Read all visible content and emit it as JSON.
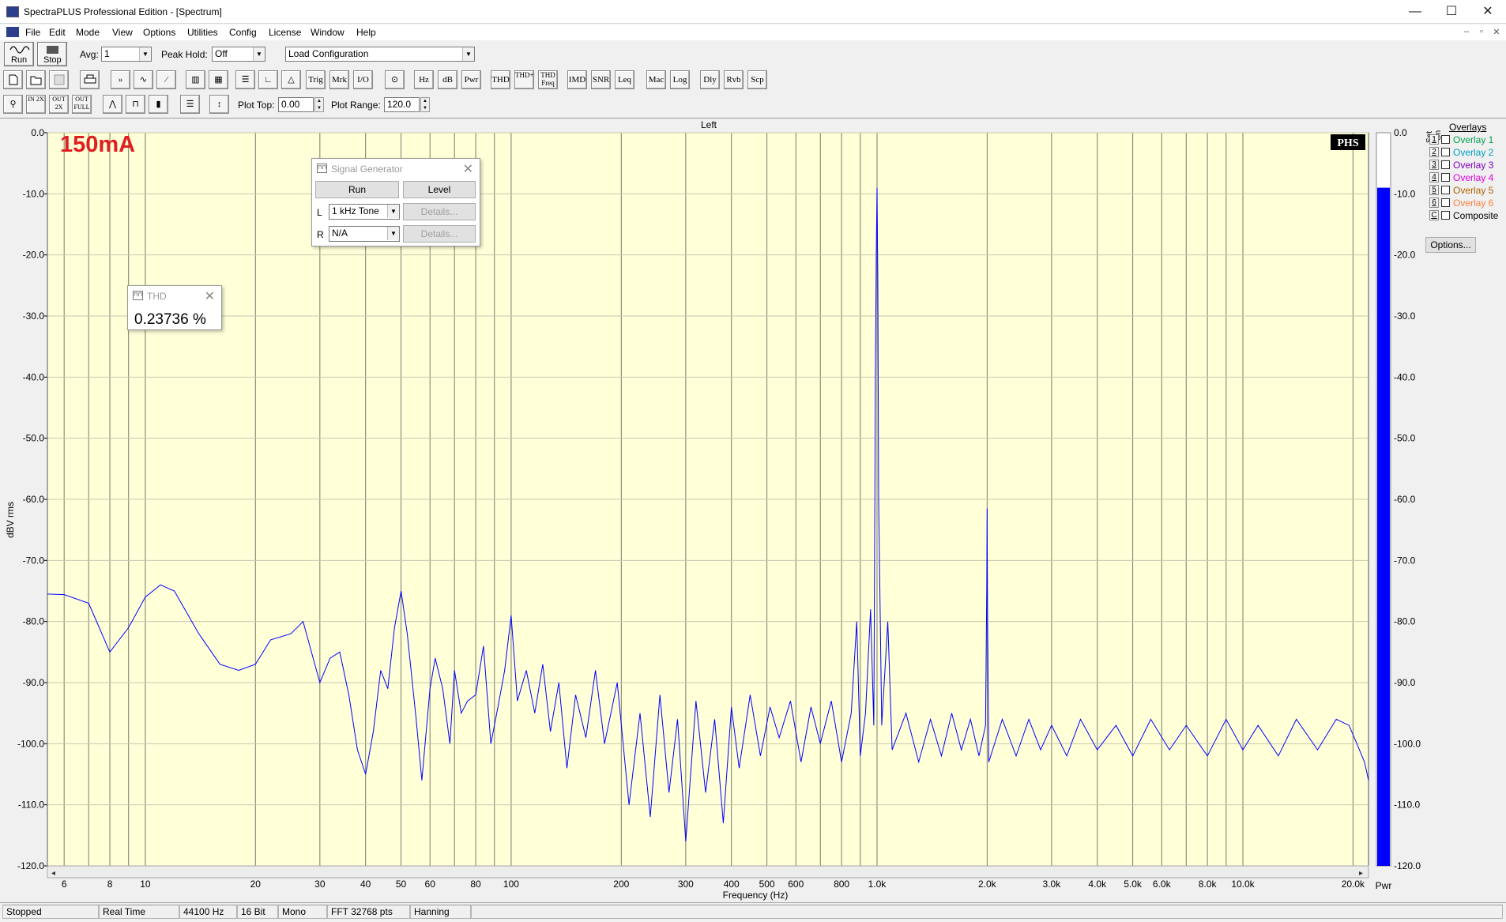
{
  "window": {
    "title": "SpectraPLUS Professional Edition - [Spectrum]",
    "controls": [
      "—",
      "☐",
      "✕"
    ]
  },
  "menu": [
    "File",
    "Edit",
    "Mode",
    "View",
    "Options",
    "Utilities",
    "Config",
    "License",
    "Window",
    "Help"
  ],
  "mdi_controls": [
    "–",
    "▫",
    "✕"
  ],
  "toolbar1": {
    "run_label": "Run",
    "stop_label": "Stop",
    "avg_label": "Avg:",
    "avg_value": "1",
    "peakhold_label": "Peak Hold:",
    "peakhold_value": "Off",
    "config_value": "Load Configuration"
  },
  "toolbar2": [
    "Trig",
    "Mrk",
    "I/O",
    "Hz",
    "dB",
    "Pwr",
    "THD",
    "THD+N",
    "THD Freq",
    "IMD",
    "SNR",
    "Leq",
    "Mac",
    "Log",
    "Dly",
    "Rvb",
    "Scp"
  ],
  "toolbar3": {
    "plot_top_label": "Plot Top:",
    "plot_top_value": "0.00",
    "plot_range_label": "Plot Range:",
    "plot_range_value": "120.0",
    "zoom_buttons": [
      "IN 2X",
      "OUT 2X",
      "OUT FULL"
    ]
  },
  "plot": {
    "channel_title": "Left",
    "annotation": "150mA",
    "logo": "PHS",
    "meter_label": "Pwr",
    "meter_value_db": -9.0,
    "colors": {
      "plot_bg": "#ffffd8",
      "trace": "#0000ff",
      "annotation": "#e02020",
      "grid": "#7a7a6a",
      "meter": "#0000ff"
    }
  },
  "chart_data": {
    "type": "line",
    "title": "Left",
    "xlabel": "Frequency (Hz)",
    "ylabel": "dBV rms",
    "xscale": "log",
    "xlim": [
      5.4,
      22050
    ],
    "ylim": [
      -120,
      0
    ],
    "grid": true,
    "xticks": [
      {
        "v": 6,
        "l": "6"
      },
      {
        "v": 8,
        "l": "8"
      },
      {
        "v": 10,
        "l": "10"
      },
      {
        "v": 20,
        "l": "20"
      },
      {
        "v": 30,
        "l": "30"
      },
      {
        "v": 40,
        "l": "40"
      },
      {
        "v": 50,
        "l": "50"
      },
      {
        "v": 60,
        "l": "60"
      },
      {
        "v": 80,
        "l": "80"
      },
      {
        "v": 100,
        "l": "100"
      },
      {
        "v": 200,
        "l": "200"
      },
      {
        "v": 300,
        "l": "300"
      },
      {
        "v": 400,
        "l": "400"
      },
      {
        "v": 500,
        "l": "500"
      },
      {
        "v": 600,
        "l": "600"
      },
      {
        "v": 800,
        "l": "800"
      },
      {
        "v": 1000,
        "l": "1.0k"
      },
      {
        "v": 2000,
        "l": "2.0k"
      },
      {
        "v": 3000,
        "l": "3.0k"
      },
      {
        "v": 4000,
        "l": "4.0k"
      },
      {
        "v": 5000,
        "l": "5.0k"
      },
      {
        "v": 6000,
        "l": "6.0k"
      },
      {
        "v": 8000,
        "l": "8.0k"
      },
      {
        "v": 10000,
        "l": "10.0k"
      },
      {
        "v": 20000,
        "l": "20.0k"
      }
    ],
    "yticks": [
      {
        "v": 0,
        "l": "0.0"
      },
      {
        "v": -10,
        "l": "-10.0"
      },
      {
        "v": -20,
        "l": "-20.0"
      },
      {
        "v": -30,
        "l": "-30.0"
      },
      {
        "v": -40,
        "l": "-40.0"
      },
      {
        "v": -50,
        "l": "-50.0"
      },
      {
        "v": -60,
        "l": "-60.0"
      },
      {
        "v": -70,
        "l": "-70.0"
      },
      {
        "v": -80,
        "l": "-80.0"
      },
      {
        "v": -90,
        "l": "-90.0"
      },
      {
        "v": -100,
        "l": "-100.0"
      },
      {
        "v": -110,
        "l": "-110.0"
      },
      {
        "v": -120,
        "l": "-120.0"
      }
    ],
    "series": [
      {
        "points": [
          [
            5.4,
            -75.5
          ],
          [
            6,
            -75.6
          ],
          [
            7,
            -77
          ],
          [
            8,
            -85
          ],
          [
            9,
            -81
          ],
          [
            10,
            -76
          ],
          [
            11,
            -74
          ],
          [
            12,
            -75
          ],
          [
            14,
            -82
          ],
          [
            16,
            -87
          ],
          [
            18,
            -88
          ],
          [
            20,
            -87
          ],
          [
            22,
            -83
          ],
          [
            25,
            -82
          ],
          [
            27,
            -80
          ],
          [
            30,
            -90
          ],
          [
            32,
            -86
          ],
          [
            34,
            -85
          ],
          [
            36,
            -92
          ],
          [
            38,
            -101
          ],
          [
            40,
            -105
          ],
          [
            42,
            -98
          ],
          [
            44,
            -88
          ],
          [
            46,
            -91
          ],
          [
            48,
            -81
          ],
          [
            50,
            -75
          ],
          [
            52,
            -82
          ],
          [
            55,
            -96
          ],
          [
            57,
            -106
          ],
          [
            60,
            -91
          ],
          [
            62,
            -86
          ],
          [
            65,
            -91
          ],
          [
            68,
            -100
          ],
          [
            70,
            -88
          ],
          [
            73,
            -95
          ],
          [
            76,
            -93
          ],
          [
            80,
            -92
          ],
          [
            84,
            -84
          ],
          [
            88,
            -100
          ],
          [
            92,
            -94
          ],
          [
            96,
            -88
          ],
          [
            100,
            -79
          ],
          [
            104,
            -93
          ],
          [
            110,
            -88
          ],
          [
            116,
            -95
          ],
          [
            122,
            -87
          ],
          [
            128,
            -98
          ],
          [
            135,
            -90
          ],
          [
            142,
            -104
          ],
          [
            150,
            -92
          ],
          [
            160,
            -99
          ],
          [
            170,
            -88
          ],
          [
            180,
            -100
          ],
          [
            195,
            -90
          ],
          [
            210,
            -110
          ],
          [
            225,
            -95
          ],
          [
            240,
            -112
          ],
          [
            255,
            -92
          ],
          [
            270,
            -108
          ],
          [
            285,
            -96
          ],
          [
            300,
            -116
          ],
          [
            320,
            -93
          ],
          [
            340,
            -108
          ],
          [
            360,
            -96
          ],
          [
            380,
            -113
          ],
          [
            400,
            -94
          ],
          [
            420,
            -104
          ],
          [
            450,
            -92
          ],
          [
            480,
            -102
          ],
          [
            510,
            -94
          ],
          [
            540,
            -99
          ],
          [
            580,
            -93
          ],
          [
            620,
            -103
          ],
          [
            660,
            -94
          ],
          [
            700,
            -100
          ],
          [
            750,
            -93
          ],
          [
            800,
            -103
          ],
          [
            850,
            -95
          ],
          [
            880,
            -80
          ],
          [
            900,
            -102
          ],
          [
            930,
            -95
          ],
          [
            960,
            -78
          ],
          [
            980,
            -97
          ],
          [
            990,
            -40
          ],
          [
            995,
            -20
          ],
          [
            1000,
            -9
          ],
          [
            1005,
            -25
          ],
          [
            1010,
            -60
          ],
          [
            1030,
            -97
          ],
          [
            1070,
            -80
          ],
          [
            1100,
            -101
          ],
          [
            1200,
            -95
          ],
          [
            1300,
            -103
          ],
          [
            1400,
            -96
          ],
          [
            1500,
            -102
          ],
          [
            1600,
            -95
          ],
          [
            1700,
            -101
          ],
          [
            1800,
            -96
          ],
          [
            1900,
            -102
          ],
          [
            1980,
            -97
          ],
          [
            1995,
            -75
          ],
          [
            2000,
            -61.5
          ],
          [
            2005,
            -80
          ],
          [
            2020,
            -103
          ],
          [
            2200,
            -96
          ],
          [
            2400,
            -102
          ],
          [
            2600,
            -96
          ],
          [
            2800,
            -101
          ],
          [
            3000,
            -97
          ],
          [
            3300,
            -102
          ],
          [
            3600,
            -96
          ],
          [
            4000,
            -101
          ],
          [
            4500,
            -97
          ],
          [
            5000,
            -102
          ],
          [
            5600,
            -96
          ],
          [
            6300,
            -101
          ],
          [
            7000,
            -97
          ],
          [
            8000,
            -102
          ],
          [
            9000,
            -96
          ],
          [
            10000,
            -101
          ],
          [
            11000,
            -97
          ],
          [
            12500,
            -102
          ],
          [
            14000,
            -96
          ],
          [
            16000,
            -101
          ],
          [
            18000,
            -96
          ],
          [
            19500,
            -97
          ],
          [
            20500,
            -100
          ],
          [
            21500,
            -103
          ],
          [
            22050,
            -106
          ]
        ]
      }
    ]
  },
  "signal_generator": {
    "title": "Signal Generator",
    "run_label": "Run",
    "level_label": "Level",
    "left_label": "L",
    "left_value": "1 kHz Tone",
    "right_label": "R",
    "right_value": "N/A",
    "details_label": "Details..."
  },
  "thd": {
    "title": "THD",
    "value": "0.23736 %"
  },
  "overlays": {
    "header": "Overlays",
    "set_label": "Set",
    "on_label": "On",
    "items": [
      {
        "key": "1",
        "label": "Overlay 1",
        "color": "#00a050"
      },
      {
        "key": "2",
        "label": "Overlay 2",
        "color": "#00a0c0"
      },
      {
        "key": "3",
        "label": "Overlay 3",
        "color": "#8000c0"
      },
      {
        "key": "4",
        "label": "Overlay 4",
        "color": "#e000e0"
      },
      {
        "key": "5",
        "label": "Overlay 5",
        "color": "#b06000"
      },
      {
        "key": "6",
        "label": "Overlay 6",
        "color": "#ff8040"
      },
      {
        "key": "C",
        "label": "Composite",
        "color": "#000000"
      }
    ],
    "options_label": "Options..."
  },
  "status": [
    "Stopped",
    "Real Time",
    "44100 Hz",
    "16 Bit",
    "Mono",
    "FFT 32768 pts",
    "Hanning"
  ]
}
